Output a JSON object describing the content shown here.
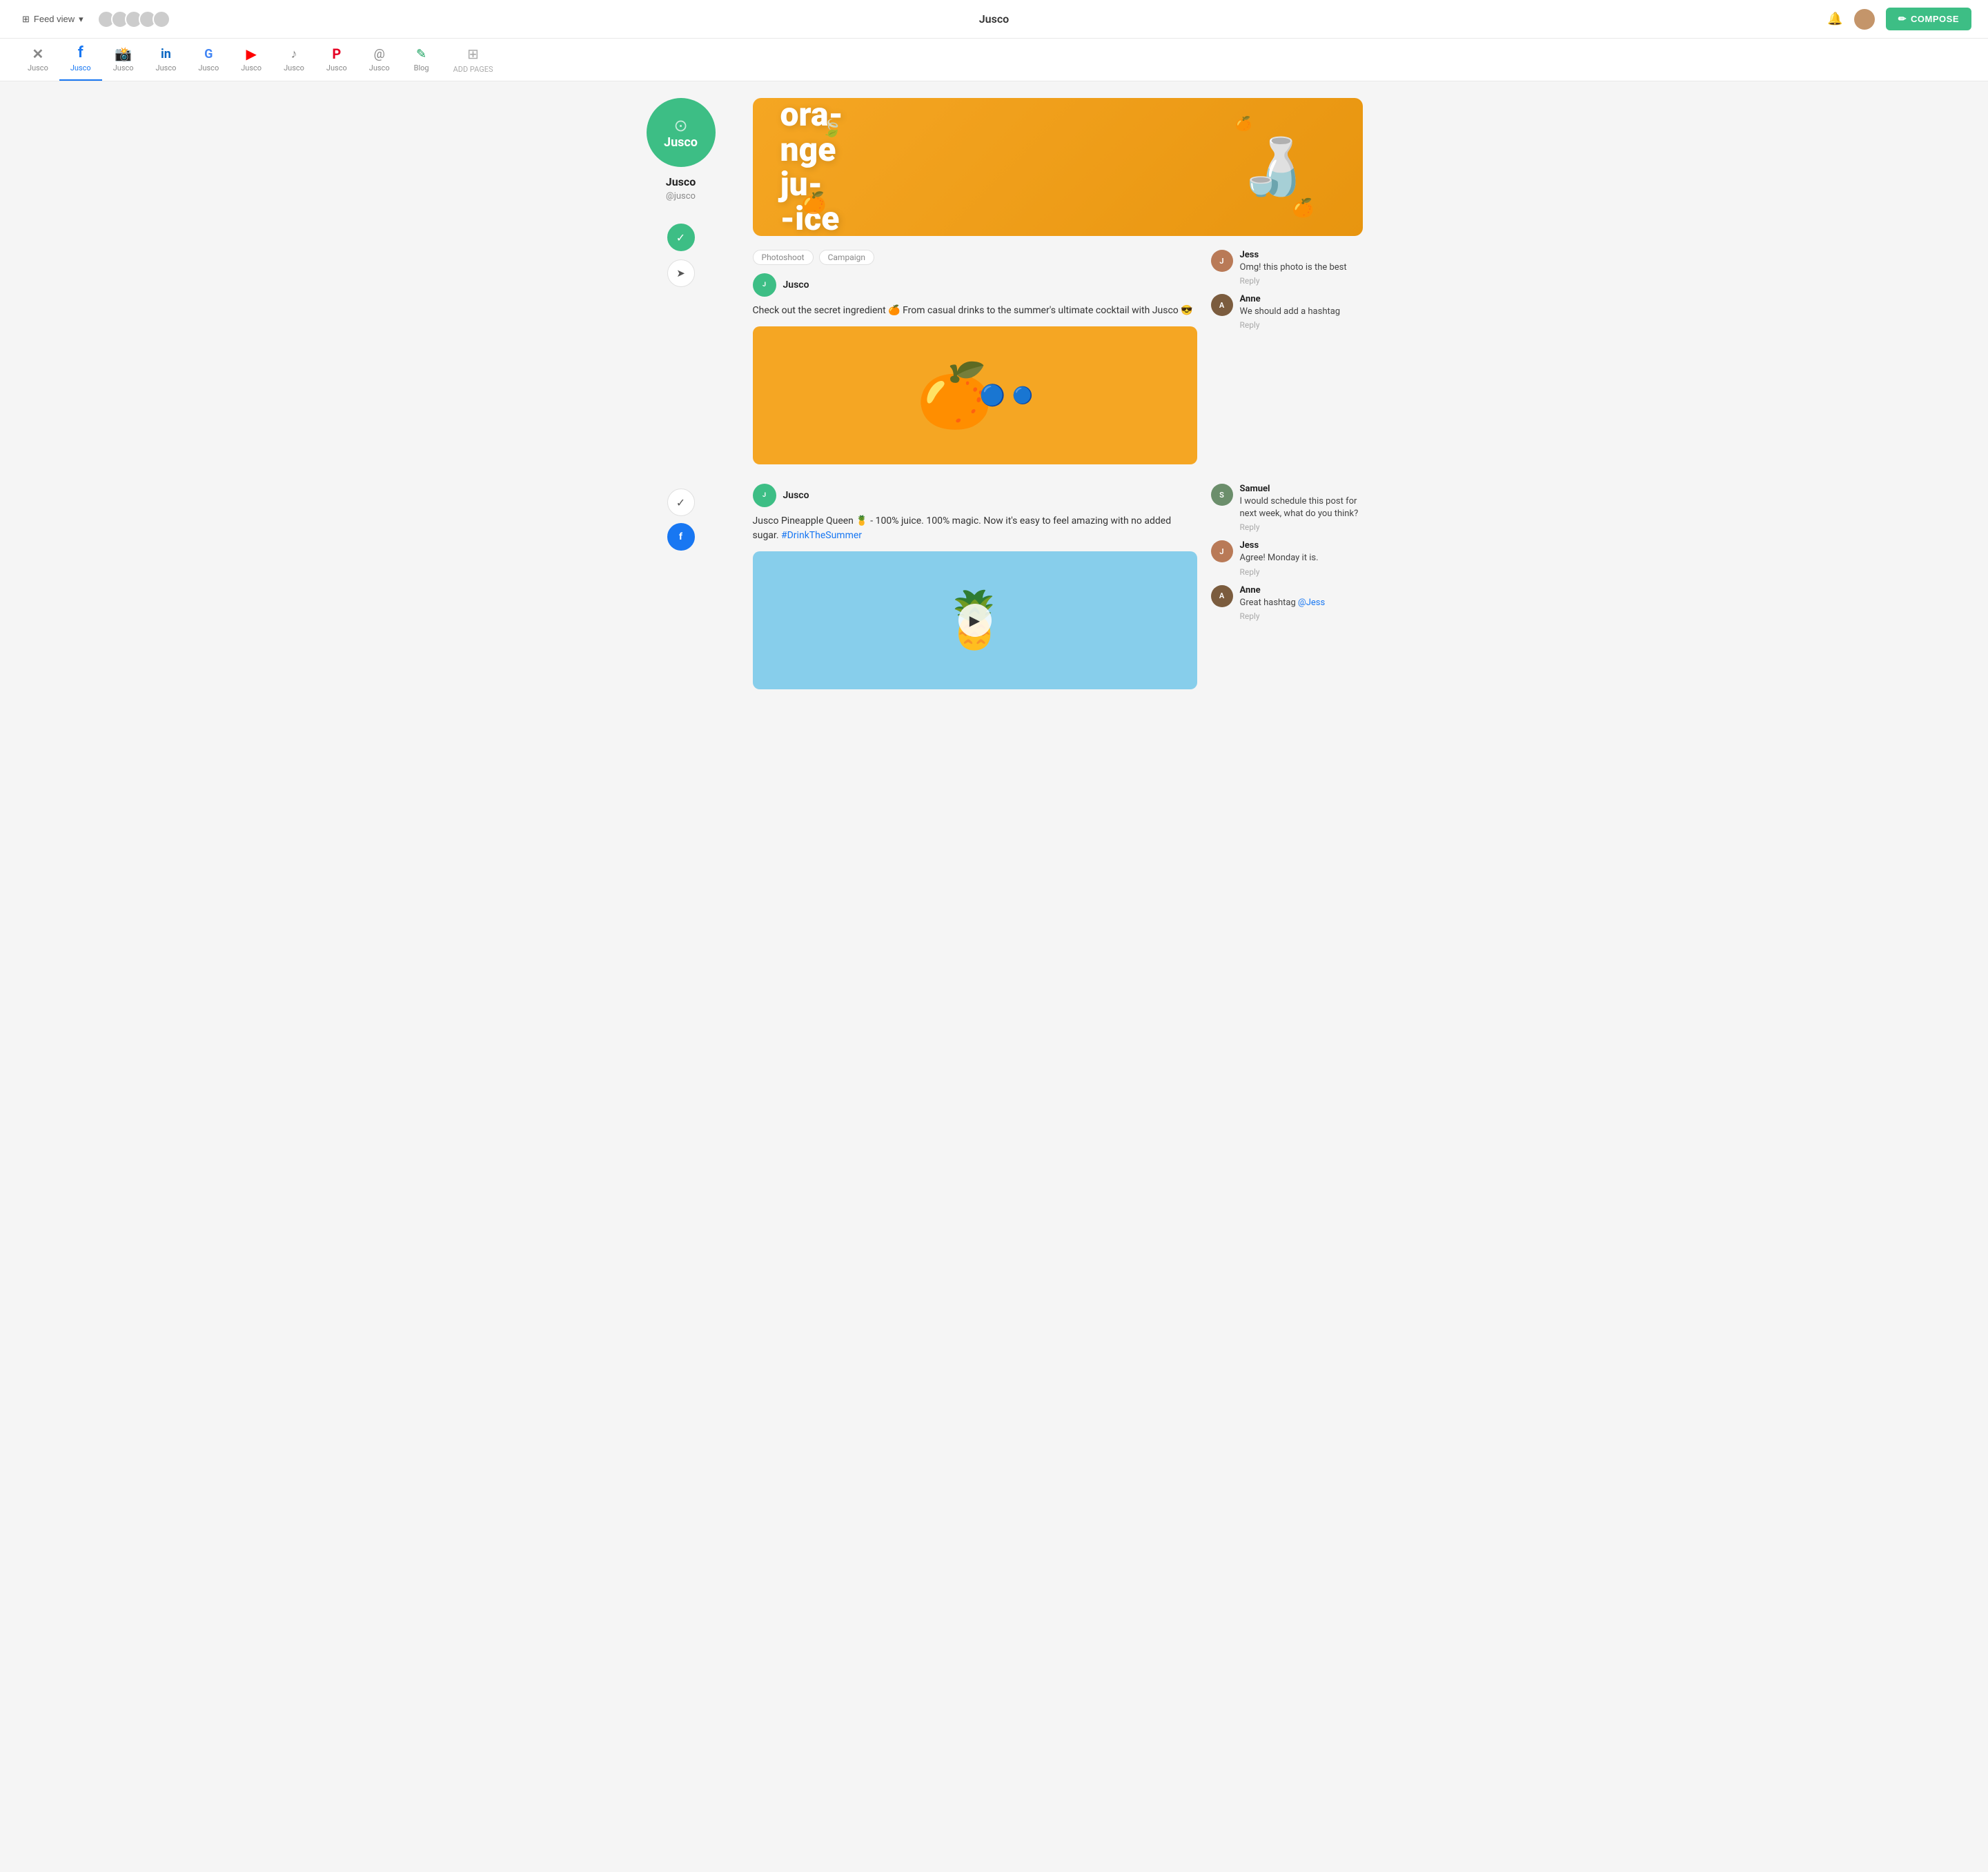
{
  "app": {
    "title": "Jusco",
    "notification_icon": "bell",
    "user_avatar": "user"
  },
  "header": {
    "feed_view_label": "Feed view",
    "compose_label": "COMPOSE"
  },
  "nav": {
    "tabs": [
      {
        "id": "x",
        "label": "Jusco",
        "icon": "✕",
        "type": "x"
      },
      {
        "id": "facebook",
        "label": "Jusco",
        "icon": "f",
        "type": "fb",
        "active": true
      },
      {
        "id": "instagram",
        "label": "Jusco",
        "icon": "◉",
        "type": "ig"
      },
      {
        "id": "linkedin",
        "label": "Jusco",
        "icon": "in",
        "type": "li"
      },
      {
        "id": "google",
        "label": "Jusco",
        "icon": "G",
        "type": "google"
      },
      {
        "id": "youtube",
        "label": "Jusco",
        "icon": "▶",
        "type": "yt"
      },
      {
        "id": "tiktok",
        "label": "Jusco",
        "icon": "♪",
        "type": "tt"
      },
      {
        "id": "pinterest",
        "label": "Jusco",
        "icon": "P",
        "type": "pi"
      },
      {
        "id": "threads",
        "label": "Jusco",
        "icon": "@",
        "type": "th"
      },
      {
        "id": "blog",
        "label": "Blog",
        "icon": "✎",
        "type": "blog"
      },
      {
        "id": "add",
        "label": "ADD PAGES",
        "icon": "⊞",
        "type": "add"
      }
    ]
  },
  "profile": {
    "name": "Jusco",
    "handle": "@jusco",
    "logo_text": "Jusco"
  },
  "banner": {
    "text": "ora-\nnge\nju-\n-ice"
  },
  "posts": [
    {
      "id": "post1",
      "tags": [
        "Photoshoot",
        "Campaign"
      ],
      "author": "Jusco",
      "body": "Check out the secret ingredient 🍊 From casual drinks to the summer's ultimate cocktail with Jusco 😎",
      "has_image": true,
      "image_type": "orange"
    },
    {
      "id": "post2",
      "tags": [],
      "author": "Jusco",
      "body_prefix": "Jusco Pineapple Queen 🍍 - 100% juice. 100% magic. Now it's easy to feel amazing with no added sugar. ",
      "hashtag": "#DrinkTheSummer",
      "has_video": true,
      "image_type": "pineapple"
    }
  ],
  "comments": {
    "post1": [
      {
        "author": "Jess",
        "type": "jess",
        "text": "Omg! this photo is the best",
        "reply_label": "Reply"
      },
      {
        "author": "Anne",
        "type": "anne",
        "text": "We should add a hashtag",
        "reply_label": "Reply"
      }
    ],
    "post2": [
      {
        "author": "Samuel",
        "type": "samuel",
        "text": "I would schedule this post for next week, what do you think?",
        "reply_label": "Reply"
      },
      {
        "author": "Jess",
        "type": "jess",
        "text": "Agree! Monday it is.",
        "reply_label": "Reply"
      },
      {
        "author": "Anne",
        "type": "anne",
        "text": "Great hashtag ",
        "mention": "@Jess",
        "reply_label": "Reply"
      }
    ]
  },
  "sidebar_actions": {
    "check_active": "✓",
    "send": "✈"
  }
}
